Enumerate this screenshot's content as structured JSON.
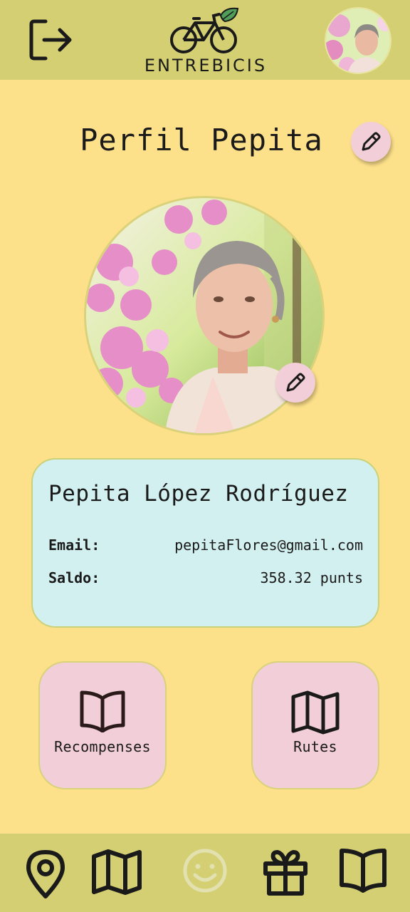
{
  "header": {
    "brand_text": "ENTREBICIS",
    "logout_icon": "logout-icon",
    "logo_icon": "bicycle-leaf-icon",
    "avatar_icon": "user-avatar"
  },
  "page": {
    "title": "Perfil Pepita"
  },
  "profile": {
    "full_name": "Pepita López Rodríguez",
    "email_label": "Email:",
    "email_value": "pepitaFlores@gmail.com",
    "saldo_label": "Saldo:",
    "saldo_value": "358.32 punts"
  },
  "actions": [
    {
      "label": "Recompenses",
      "icon": "open-book-icon"
    },
    {
      "label": "Rutes",
      "icon": "map-icon"
    }
  ],
  "bottom_nav": [
    {
      "icon": "location-pin-icon",
      "active": false
    },
    {
      "icon": "map-icon",
      "active": false
    },
    {
      "icon": "smiley-icon",
      "active": true
    },
    {
      "icon": "gift-icon",
      "active": false
    },
    {
      "icon": "book-icon",
      "active": false
    }
  ],
  "colors": {
    "background": "#fde08a",
    "bars": "#d3cf72",
    "card": "#d3f0f0",
    "pink": "#f2cfd8",
    "active_nav": "#e3e1b0"
  }
}
